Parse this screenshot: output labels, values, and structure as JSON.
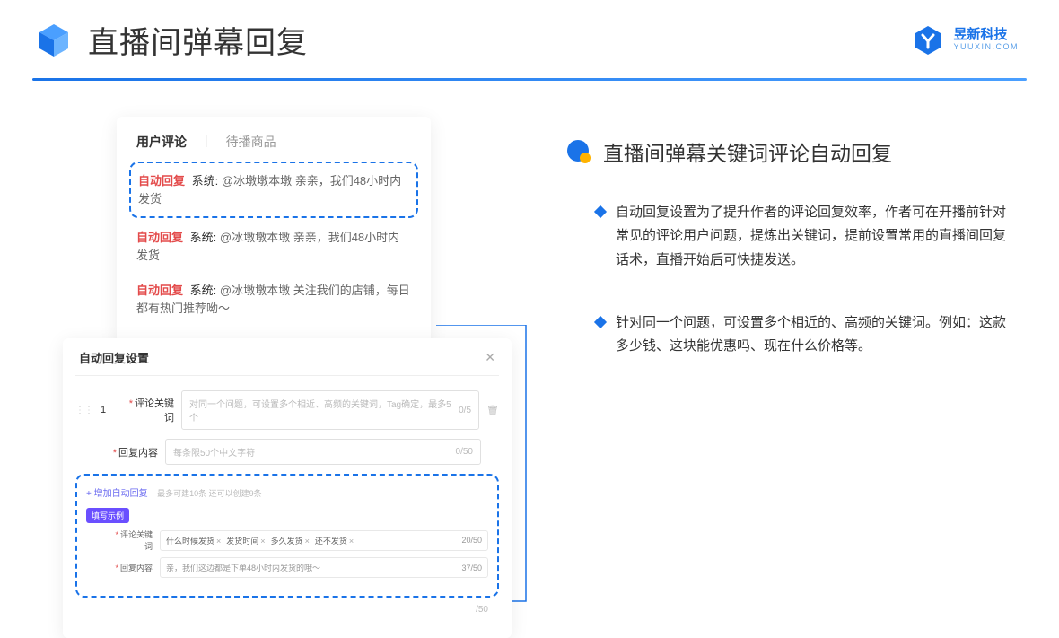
{
  "header": {
    "title": "直播间弹幕回复",
    "brand_name": "昱新科技",
    "brand_sub": "YUUXIN.COM"
  },
  "comments_card": {
    "tab1": "用户评论",
    "tab2": "待播商品",
    "auto_label": "自动回复",
    "sys_label": "系统:",
    "row1": "@冰墩墩本墩 亲亲，我们48小时内发货",
    "row2": "@冰墩墩本墩 亲亲，我们48小时内发货",
    "row3": "@冰墩墩本墩 关注我们的店铺，每日都有热门推荐呦～"
  },
  "settings_card": {
    "title": "自动回复设置",
    "row_num": "1",
    "kw_label": "评论关键词",
    "kw_placeholder": "对同一个问题，可设置多个相近、高频的关键词，Tag确定，最多5个",
    "kw_counter": "0/5",
    "content_label": "回复内容",
    "content_placeholder": "每条限50个中文字符",
    "content_counter": "0/50",
    "add_link": "+ 增加自动回复",
    "add_hint": "最多可建10条 还可以创建9条",
    "badge": "填写示例",
    "ex_kw_label": "评论关键词",
    "ex_tag1": "什么时候发货",
    "ex_tag2": "发货时间",
    "ex_tag3": "多久发货",
    "ex_tag4": "还不发货",
    "ex_kw_counter": "20/50",
    "ex_content_label": "回复内容",
    "ex_content_val": "亲，我们这边都是下单48小时内发货的哦～",
    "ex_content_counter": "37/50",
    "stub_counter": "/50"
  },
  "right": {
    "section_title": "直播间弹幕关键词评论自动回复",
    "bullet1": "自动回复设置为了提升作者的评论回复效率，作者可在开播前针对常见的评论用户问题，提炼出关键词，提前设置常用的直播间回复话术，直播开始后可快捷发送。",
    "bullet2": "针对同一个问题，可设置多个相近的、高频的关键词。例如：这款多少钱、这块能优惠吗、现在什么价格等。"
  }
}
